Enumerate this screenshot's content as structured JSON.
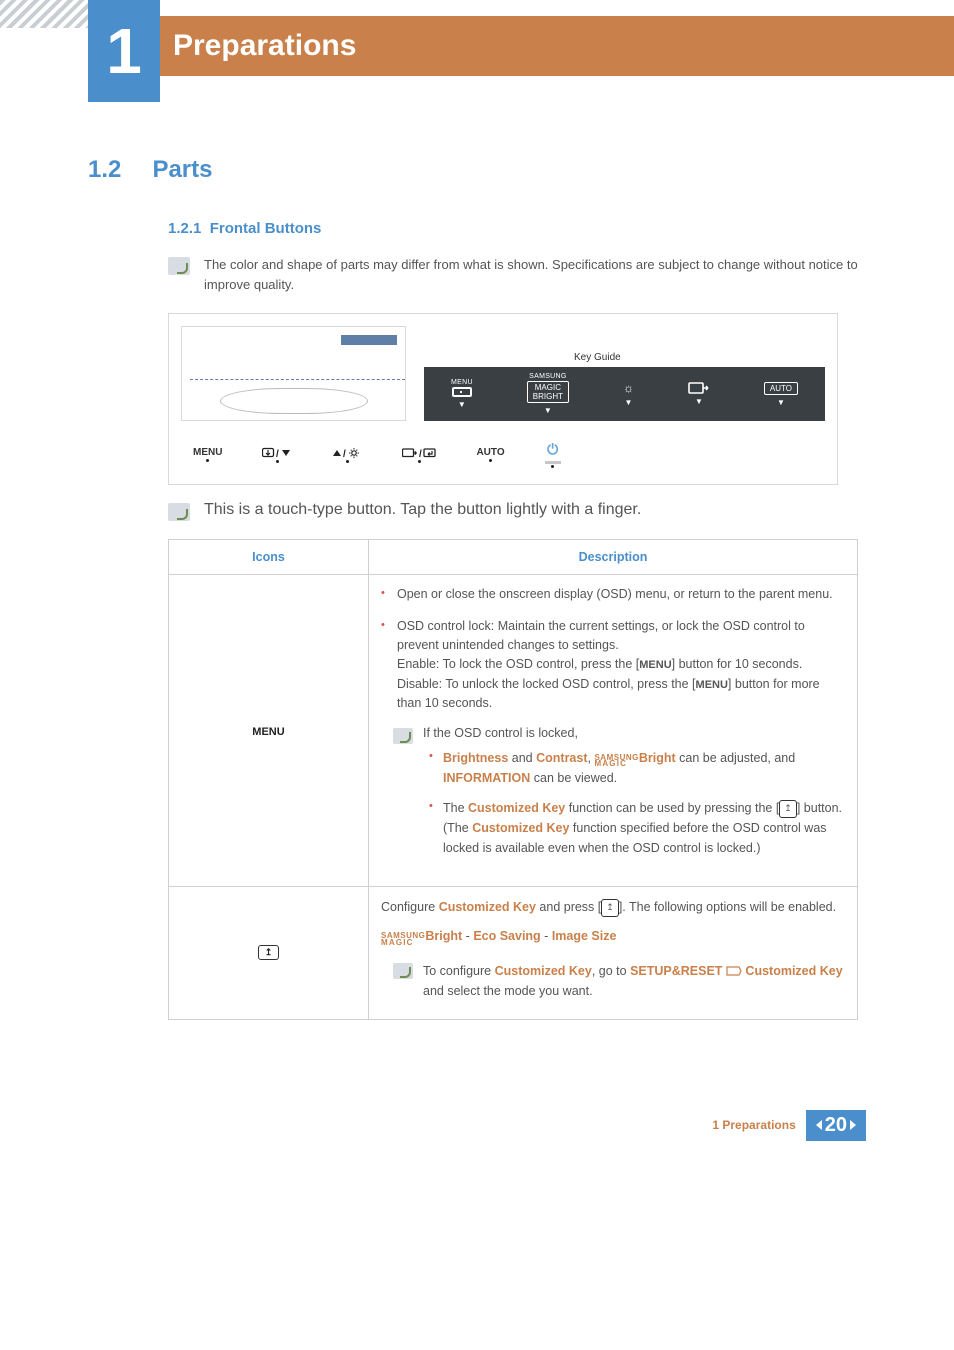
{
  "header": {
    "chapter_number": "1",
    "chapter_title": "Preparations"
  },
  "section": {
    "number": "1.2",
    "title": "Parts"
  },
  "subsection": {
    "number": "1.2.1",
    "title": "Frontal Buttons"
  },
  "note1": "The color and shape of parts may differ from what is shown. Specifications are subject to change without notice to improve quality.",
  "figure": {
    "key_guide_label": "Key Guide",
    "kg_items": {
      "menu": "MENU",
      "samsung": "SAMSUNG",
      "magic": "MAGIC",
      "bright": "BRIGHT",
      "auto": "AUTO"
    },
    "buttons": {
      "menu": "MENU",
      "auto": "AUTO"
    }
  },
  "note2": "This is a touch-type button. Tap the button lightly with a finger.",
  "table": {
    "headers": {
      "icons": "Icons",
      "description": "Description"
    },
    "row1": {
      "icon_label": "MENU",
      "bullet1": "Open or close the onscreen display (OSD) menu, or return to the parent menu.",
      "bullet2_a": "OSD control lock: Maintain the current settings, or lock the OSD control to prevent unintended changes to settings.",
      "bullet2_b": "Enable: To lock the OSD control, press the [",
      "bullet2_b_btn": "MENU",
      "bullet2_b2": "] button for 10 seconds.",
      "bullet2_c": "Disable: To unlock the locked OSD control, press the [",
      "bullet2_c_btn": "MENU",
      "bullet2_c2": "] button for more than 10 seconds.",
      "lock_note": "If the OSD control is locked,",
      "sub1_a": "Brightness",
      "sub1_and": " and ",
      "sub1_b": "Contrast",
      "sub1_mid": ", ",
      "sub1_magic1": "SAMSUNG",
      "sub1_magic2": "MAGIC",
      "sub1_c": "Bright",
      "sub1_tail": " can be adjusted, and ",
      "sub1_d": "INFORMATION",
      "sub1_end": " can be viewed.",
      "sub2_a": "The ",
      "sub2_b": "Customized Key",
      "sub2_c": " function can be used by pressing the [",
      "sub2_d": "] button. (The ",
      "sub2_e": "Customized Key",
      "sub2_f": " function specified before the OSD control was locked is available even when the OSD control is locked.)"
    },
    "row2": {
      "line1_a": "Configure ",
      "line1_b": "Customized Key",
      "line1_c": " and press [",
      "line1_d": "]. The following options will be enabled.",
      "opts_magic1": "SAMSUNG",
      "opts_magic2": "MAGIC",
      "opts_a": "Bright",
      "opts_sep": " - ",
      "opts_b": "Eco Saving",
      "opts_c": "Image Size",
      "note_a": "To configure ",
      "note_b": "Customized Key",
      "note_c": ", go to ",
      "note_d": "SETUP&RESET",
      "note_e": "Customized Key",
      "note_f": " and select the mode you want."
    }
  },
  "footer": {
    "text": "1 Preparations",
    "page": "20"
  }
}
